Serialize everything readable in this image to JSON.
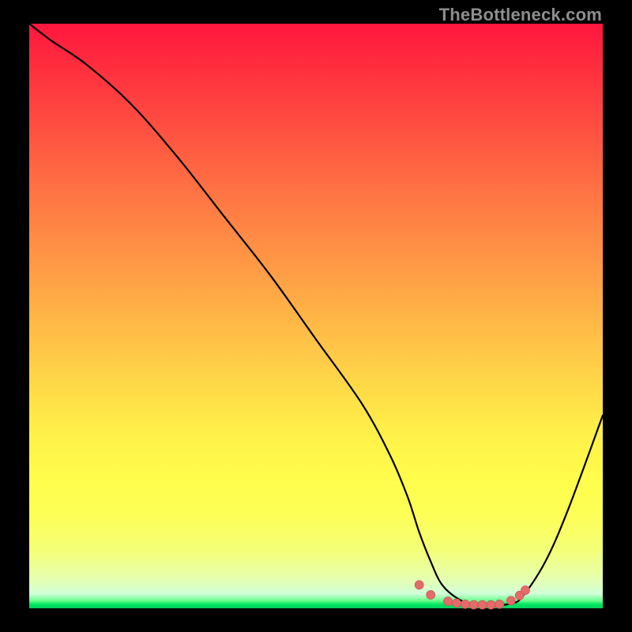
{
  "watermark": "TheBottleneck.com",
  "chart_data": {
    "type": "line",
    "title": "",
    "xlabel": "",
    "ylabel": "",
    "xlim": [
      0,
      100
    ],
    "ylim": [
      0,
      100
    ],
    "grid": false,
    "series": [
      {
        "name": "bottleneck-curve",
        "x": [
          0,
          4,
          10,
          18,
          26,
          34,
          42,
          50,
          58,
          63,
          66,
          68,
          70,
          72,
          75,
          78,
          81,
          84,
          86,
          90,
          94,
          100
        ],
        "y": [
          100,
          97,
          93,
          86,
          77,
          67,
          57,
          46,
          35,
          26,
          19,
          13,
          8,
          4,
          1.5,
          0.6,
          0.5,
          0.8,
          2,
          8,
          17,
          33
        ]
      }
    ],
    "markers": {
      "name": "valley-dots",
      "points": [
        {
          "x": 68,
          "y": 4.0
        },
        {
          "x": 70,
          "y": 2.3
        },
        {
          "x": 73,
          "y": 1.2
        },
        {
          "x": 74.5,
          "y": 0.9
        },
        {
          "x": 76,
          "y": 0.7
        },
        {
          "x": 77.5,
          "y": 0.6
        },
        {
          "x": 79,
          "y": 0.6
        },
        {
          "x": 80.5,
          "y": 0.6
        },
        {
          "x": 82,
          "y": 0.7
        },
        {
          "x": 84,
          "y": 1.3
        },
        {
          "x": 85.5,
          "y": 2.2
        },
        {
          "x": 86.5,
          "y": 3.1
        }
      ]
    },
    "background_gradient": {
      "top": "#ff163e",
      "mid": "#fff049",
      "bottom": "#00d060"
    }
  }
}
